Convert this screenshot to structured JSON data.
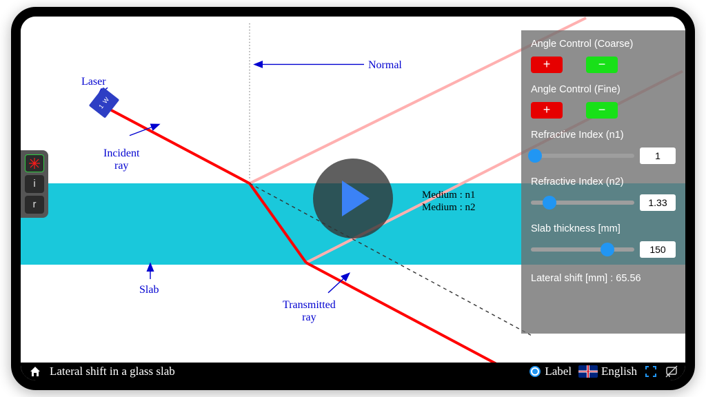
{
  "labels": {
    "laser": "Laser",
    "incident_ray_l1": "Incident",
    "incident_ray_l2": "ray",
    "slab": "Slab",
    "transmitted_l1": "Transmitted",
    "transmitted_l2": "ray",
    "normal": "Normal",
    "medium_n1": "Medium : n1",
    "medium_n2": "Medium : n2",
    "laser_power": "1 W"
  },
  "controls": {
    "angle_coarse_title": "Angle Control (Coarse)",
    "angle_fine_title": "Angle Control (Fine)",
    "plus": "+",
    "minus": "−",
    "n1_title": "Refractive Index (n1)",
    "n1_value": "1",
    "n2_title": "Refractive Index (n2)",
    "n2_value": "1.33",
    "thickness_title": "Slab thickness [mm]",
    "thickness_value": "150",
    "lateral_shift": "Lateral shift [mm] : 65.56"
  },
  "left_toolbar": {
    "i": "i",
    "r": "r"
  },
  "bottom_bar": {
    "title": "Lateral shift in a glass slab",
    "label_toggle": "Label",
    "language": "English"
  },
  "chart_data": {
    "type": "diagram",
    "title": "Lateral shift in a glass slab",
    "media": {
      "n1": 1,
      "n2": 1.33
    },
    "slab_thickness_mm": 150,
    "lateral_shift_mm": 65.56,
    "rays": [
      {
        "name": "incident",
        "from": [
          126,
          134
        ],
        "to": [
          332,
          244
        ],
        "color": "#ff0000"
      },
      {
        "name": "refracted",
        "from": [
          332,
          244
        ],
        "to": [
          414,
          360
        ],
        "color": "#ff0000"
      },
      {
        "name": "transmitted",
        "from": [
          414,
          360
        ],
        "to": [
          690,
          508
        ],
        "color": "#ff0000"
      },
      {
        "name": "undeviated_dashed",
        "from": [
          332,
          244
        ],
        "to": [
          740,
          466
        ],
        "style": "dashed"
      },
      {
        "name": "reflected_faint_top",
        "from": [
          332,
          244
        ],
        "to": [
          820,
          2
        ],
        "color": "#ffb0b0"
      },
      {
        "name": "reflected_faint_bottom",
        "from": [
          414,
          360
        ],
        "to": [
          960,
          80
        ],
        "color": "#ffb0b0"
      }
    ],
    "normal_line_x": 332,
    "annotations": [
      "Laser",
      "Incident ray",
      "Slab",
      "Transmitted ray",
      "Normal",
      "Medium : n1",
      "Medium : n2"
    ]
  }
}
